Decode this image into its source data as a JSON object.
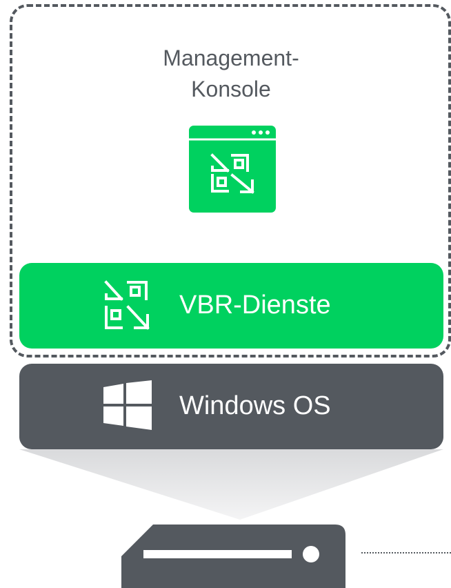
{
  "console": {
    "title_line1": "Management-",
    "title_line2": "Konsole",
    "icon": "veeam-console-window-icon"
  },
  "services": {
    "label": "VBR-Dienste",
    "icon": "veeam-vbr-icon"
  },
  "os": {
    "label": "Windows OS",
    "icon": "windows-logo-icon"
  },
  "server": {
    "icon": "server-icon"
  },
  "colors": {
    "green": "#00d15f",
    "dark_gray": "#54595f",
    "light_gray": "#e6e7e8",
    "white": "#ffffff"
  }
}
